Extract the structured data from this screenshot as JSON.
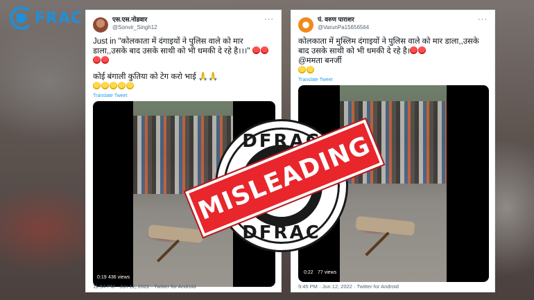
{
  "brand": {
    "logo_text": "FRAC"
  },
  "tweets": [
    {
      "display_name": "एस.एस.नोडवार",
      "handle": "@Sonvir_Singh12",
      "text_lines": [
        "Just  in \"कोलकाता में दंगाइयों ने पुलिस वाले को मार डाला,,उसके बाद उसके साथी को भी धमकी दे रहे है।।।\"",
        "कोई बंगाली कुतिया को टेग करो भाई 🙏🙏"
      ],
      "translate": "Translate Tweet",
      "video_time": "0:19",
      "video_views": "436 views",
      "meta": "11:54 PM · Jun 12, 2022 · Twitter for Android"
    },
    {
      "display_name": "पं. वरुण पाराशर",
      "handle": "@VarunPa15656564",
      "text_lines": [
        "कोलकाता में मुस्लिम दंगाइयों ने पुलिस वाले को मार डाला,,उसके बाद उसके साथी को भी धमकी दे रहे है।",
        "@ममता बनर्जी"
      ],
      "translate": "Translate Tweet",
      "video_time": "0:22",
      "video_views": "77 views",
      "meta": "9:45 PM · Jun 12, 2022 · Twitter for Android"
    }
  ],
  "stamp": {
    "top_text": "DFRAC",
    "bottom_text": "DFRAC",
    "label": "MISLEADING"
  }
}
